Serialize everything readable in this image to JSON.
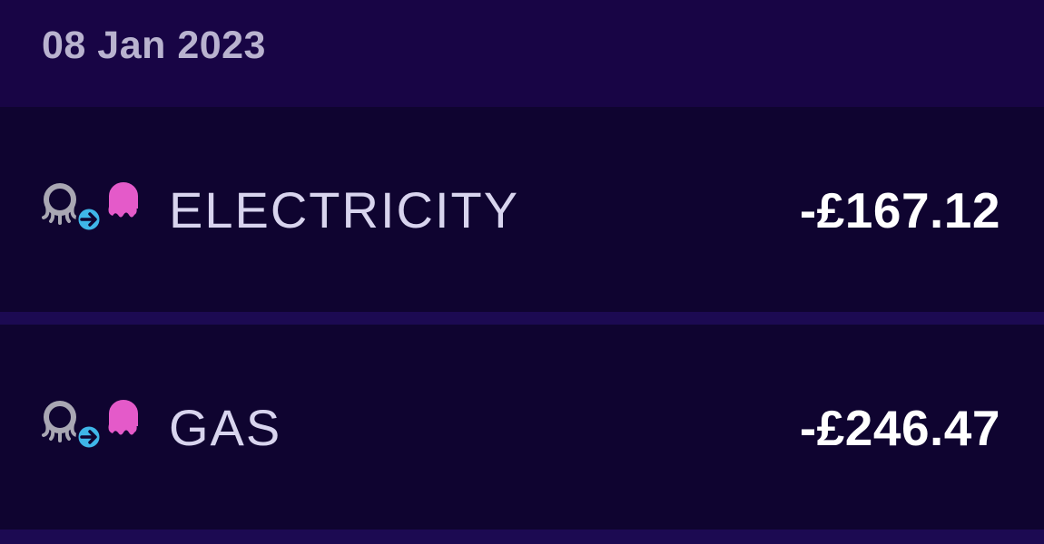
{
  "header": {
    "date": "08 Jan 2023"
  },
  "transactions": [
    {
      "label": "ELECTRICITY",
      "amount": "-£167.12",
      "icons": [
        "octopus-outline-icon",
        "transfer-arrow-icon",
        "octopus-pink-icon"
      ]
    },
    {
      "label": "GAS",
      "amount": "-£246.47",
      "icons": [
        "octopus-outline-icon",
        "transfer-arrow-icon",
        "octopus-pink-icon"
      ]
    }
  ],
  "colors": {
    "background": "#180545",
    "row_background": "#0f0430",
    "divider": "#1c0a52",
    "date_text": "#b9b3cf",
    "label_text": "#d8d4ee",
    "amount_text": "#ffffff",
    "octopus_outline": "#a9a7b3",
    "transfer_arrow": "#3fb6e8",
    "octopus_pink": "#e45ac9"
  }
}
